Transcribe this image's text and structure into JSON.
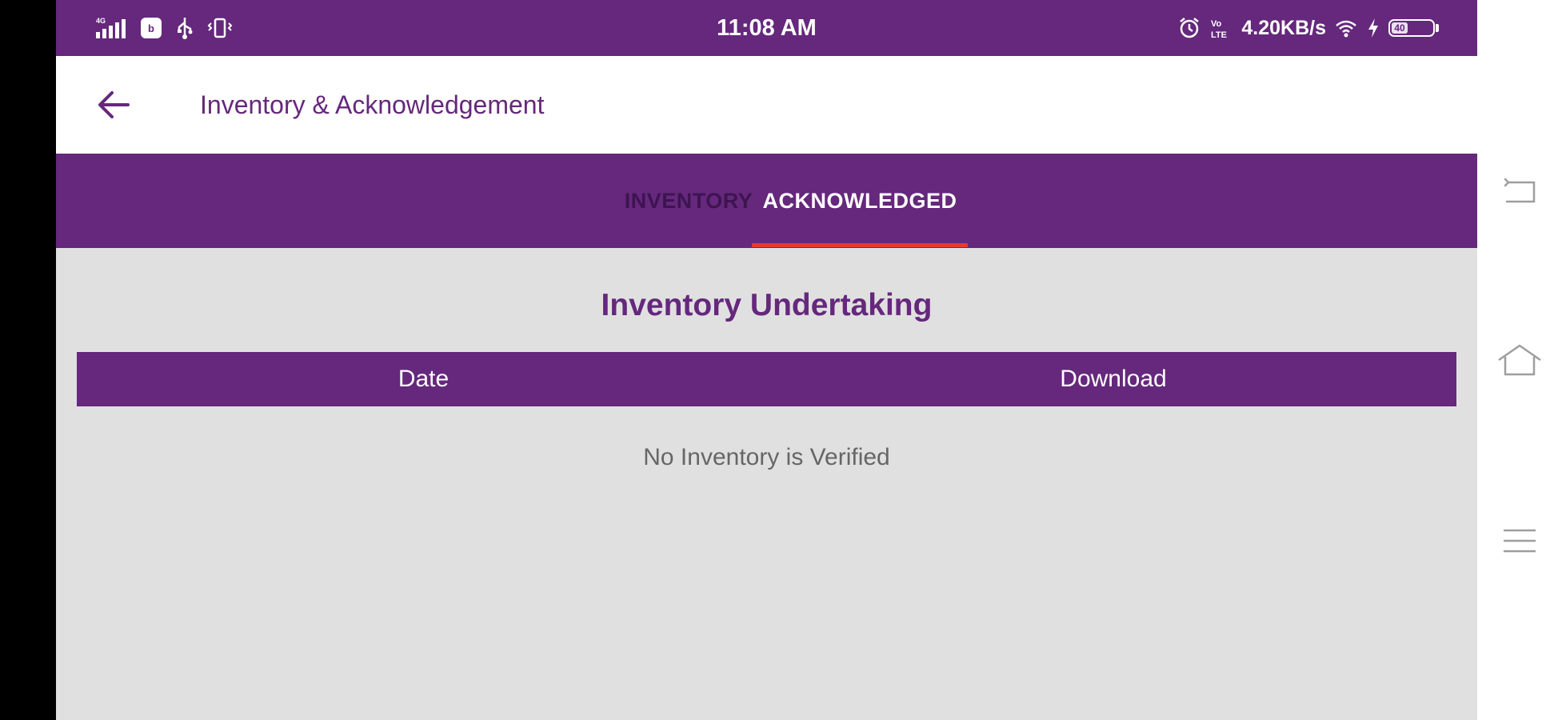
{
  "status_bar": {
    "time": "11:08 AM",
    "network_speed": "4.20KB/s",
    "battery_level": "40",
    "left_icons": [
      "signal-icon",
      "app-notification-icon",
      "usb-icon",
      "vibrate-icon"
    ],
    "right_icons": [
      "alarm-icon",
      "volte-icon",
      "wifi-icon",
      "charging-icon",
      "battery-icon"
    ]
  },
  "app_bar": {
    "title": "Inventory & Acknowledgement",
    "back_icon": "arrow-left-icon"
  },
  "tabs": [
    {
      "label": "INVENTORY",
      "active": false
    },
    {
      "label": "ACKNOWLEDGED",
      "active": true
    }
  ],
  "content": {
    "section_title": "Inventory Undertaking",
    "table_headers": {
      "date": "Date",
      "download": "Download"
    },
    "empty_message": "No Inventory is Verified"
  },
  "system_nav": [
    "back-icon",
    "home-icon",
    "menu-icon"
  ],
  "colors": {
    "primary": "#65287c",
    "tab_indicator": "#e53935",
    "background": "#e0e0e0"
  }
}
